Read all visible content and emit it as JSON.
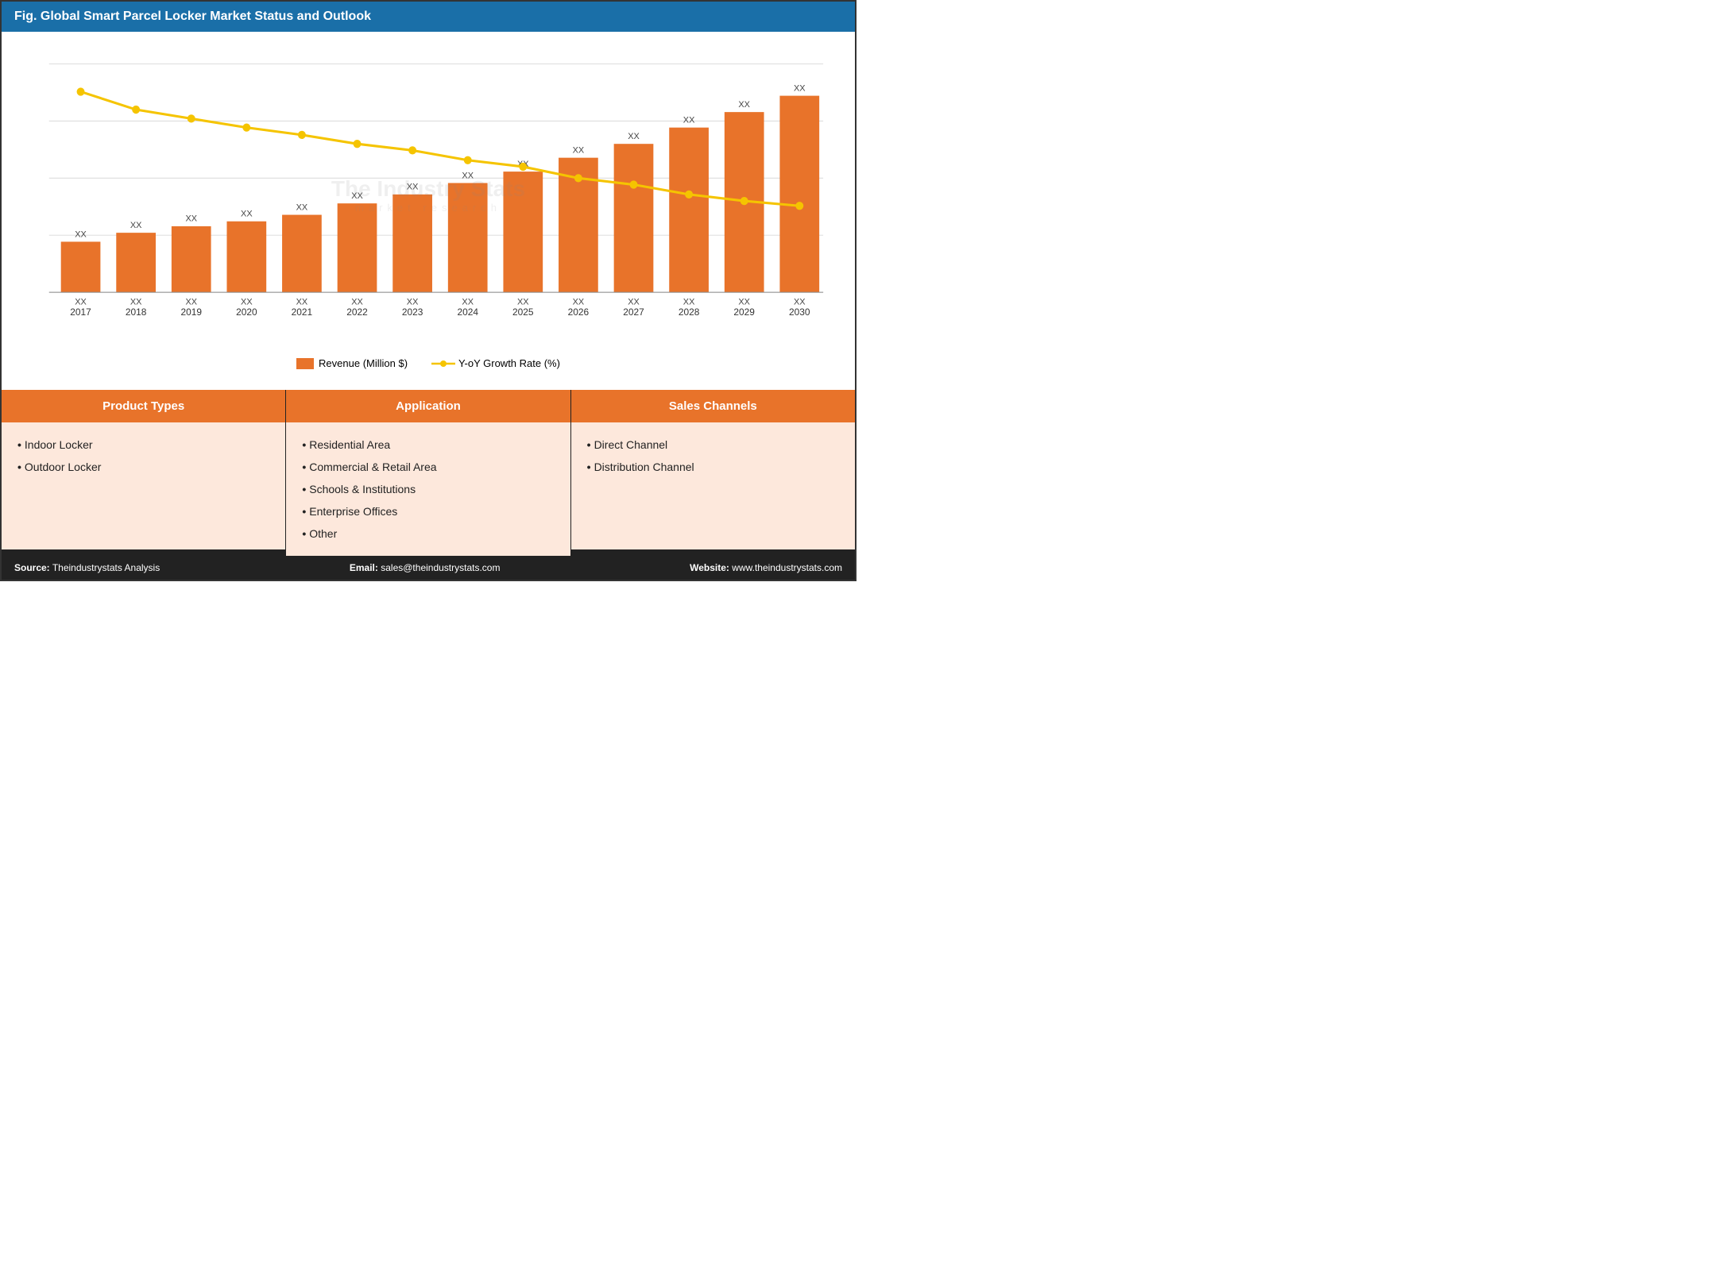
{
  "header": {
    "title": "Fig. Global Smart Parcel Locker Market Status and Outlook"
  },
  "chart": {
    "years": [
      "2017",
      "2018",
      "2019",
      "2020",
      "2021",
      "2022",
      "2023",
      "2024",
      "2025",
      "2026",
      "2027",
      "2028",
      "2029",
      "2030"
    ],
    "bar_label": "Revenue (Million $)",
    "line_label": "Y-oY Growth Rate (%)",
    "bar_color": "#e8732a",
    "line_color": "#f5c400",
    "value_label": "XX",
    "bar_heights": [
      0.22,
      0.26,
      0.29,
      0.31,
      0.34,
      0.39,
      0.43,
      0.48,
      0.53,
      0.59,
      0.65,
      0.72,
      0.79,
      0.86
    ],
    "line_heights": [
      0.88,
      0.8,
      0.76,
      0.72,
      0.69,
      0.65,
      0.62,
      0.58,
      0.55,
      0.5,
      0.47,
      0.43,
      0.4,
      0.38
    ]
  },
  "categories": [
    {
      "id": "product-types",
      "header": "Product Types",
      "items": [
        "Indoor Locker",
        "Outdoor Locker"
      ]
    },
    {
      "id": "application",
      "header": "Application",
      "items": [
        "Residential Area",
        "Commercial & Retail Area",
        "Schools & Institutions",
        "Enterprise Offices",
        "Other"
      ]
    },
    {
      "id": "sales-channels",
      "header": "Sales Channels",
      "items": [
        "Direct Channel",
        "Distribution Channel"
      ]
    }
  ],
  "footer": {
    "source_label": "Source:",
    "source_value": "Theindustrystats Analysis",
    "email_label": "Email:",
    "email_value": "sales@theindustrystats.com",
    "website_label": "Website:",
    "website_value": "www.theindustrystats.com"
  },
  "watermark": {
    "name": "The Industry Stats",
    "sub": "market  research"
  }
}
